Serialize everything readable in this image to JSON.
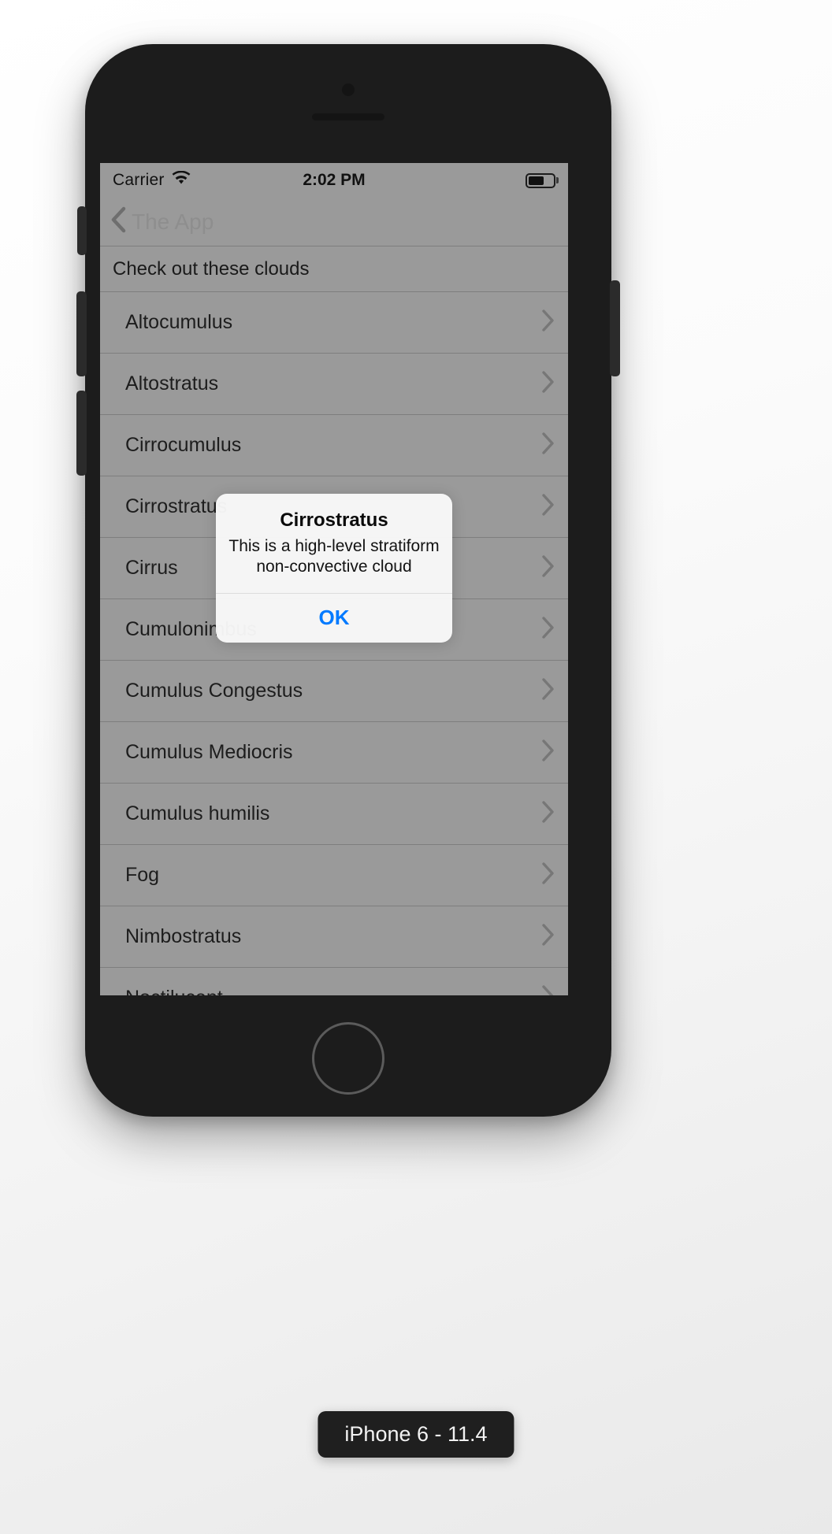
{
  "simulator": {
    "device_label": "iPhone 6 - 11.4"
  },
  "status_bar": {
    "carrier": "Carrier",
    "wifi_icon": "wifi-icon",
    "time": "2:02 PM",
    "battery_icon": "battery-icon",
    "battery_level_percent": 62
  },
  "nav_bar": {
    "back_icon": "chevron-left-icon",
    "back_label": "The App"
  },
  "list": {
    "section_header": "Check out these clouds",
    "disclosure_icon": "chevron-right-icon",
    "rows": [
      {
        "label": "Altocumulus"
      },
      {
        "label": "Altostratus"
      },
      {
        "label": "Cirrocumulus"
      },
      {
        "label": "Cirrostratus"
      },
      {
        "label": "Cirrus"
      },
      {
        "label": "Cumulonimbus"
      },
      {
        "label": "Cumulus Congestus"
      },
      {
        "label": "Cumulus Mediocris"
      },
      {
        "label": "Cumulus humilis"
      },
      {
        "label": "Fog"
      },
      {
        "label": "Nimbostratus"
      },
      {
        "label": "Noctilucent"
      }
    ]
  },
  "alert": {
    "title": "Cirrostratus",
    "message": "This is a high-level stratiform non-convective cloud",
    "ok_label": "OK",
    "accent_color": "#007aff"
  },
  "hardware": {
    "mute_switch": "mute-switch",
    "volume_up": "volume-up-button",
    "volume_down": "volume-down-button",
    "power": "power-button",
    "home": "home-button"
  }
}
